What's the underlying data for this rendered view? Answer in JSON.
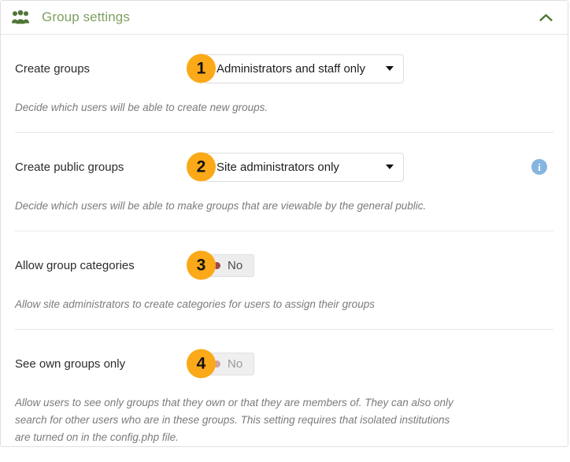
{
  "header": {
    "icon": "users-group-icon",
    "title": "Group settings",
    "toggle_icon": "chevron-up-icon",
    "title_color": "#7ea05f",
    "icon_color": "#4f7637"
  },
  "colors": {
    "badge_bg": "#fba919",
    "info_bg": "#85b5e0",
    "switch_dot_off": "#9c4a4a"
  },
  "settings": [
    {
      "badge": "1",
      "label": "Create groups",
      "control": "select",
      "value": "Administrators and staff only",
      "description": "Decide which users will be able to create new groups.",
      "info": false
    },
    {
      "badge": "2",
      "label": "Create public groups",
      "control": "select",
      "value": "Site administrators only",
      "description": "Decide which users will be able to make groups that are viewable by the general public.",
      "info": true,
      "info_icon": "info-circle-icon"
    },
    {
      "badge": "3",
      "label": "Allow group categories",
      "control": "switch",
      "value": "No",
      "description": "Allow site administrators to create categories for users to assign their groups",
      "info": false,
      "disabled": false
    },
    {
      "badge": "4",
      "label": "See own groups only",
      "control": "switch",
      "value": "No",
      "description": "Allow users to see only groups that they own or that they are members of. They can also only search for other users who are in these groups. This setting requires that isolated institutions are turned on in the config.php file.",
      "info": false,
      "disabled": true
    }
  ]
}
